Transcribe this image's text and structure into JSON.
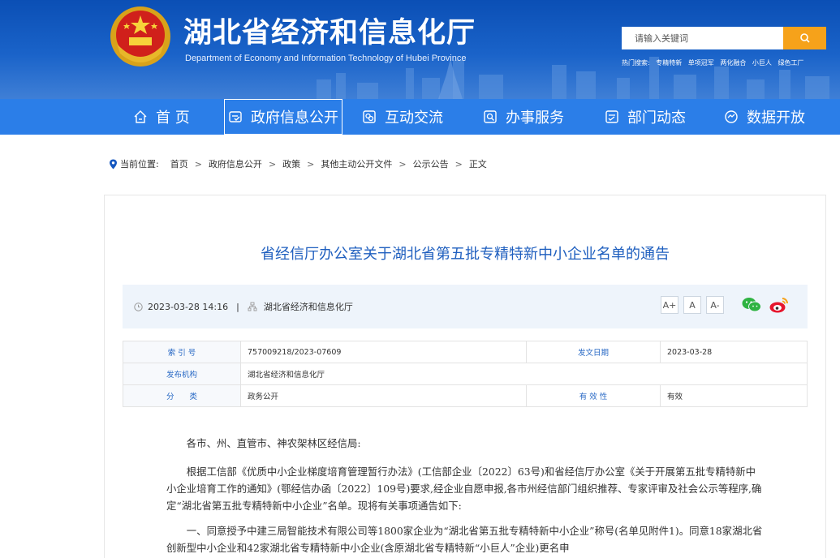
{
  "header": {
    "title": "湖北省经济和信息化厅",
    "subtitle": "Department of Economy and Information Technology of Hubei Province",
    "search_placeholder": "请输入关键词",
    "search_button_icon": "search-icon",
    "hot_label": "热门搜索:",
    "hot_words": [
      "专精特新",
      "单项冠军",
      "两化融合",
      "小巨人",
      "绿色工厂"
    ]
  },
  "nav": {
    "items": [
      {
        "label": "首 页",
        "icon": "home-icon"
      },
      {
        "label": "政府信息公开",
        "icon": "document-icon"
      },
      {
        "label": "互动交流",
        "icon": "chat-icon"
      },
      {
        "label": "办事服务",
        "icon": "search-service-icon"
      },
      {
        "label": "部门动态",
        "icon": "news-icon"
      },
      {
        "label": "数据开放",
        "icon": "data-icon"
      }
    ],
    "active_index": 1
  },
  "breadcrumb": {
    "label": "当前位置:",
    "items": [
      "首页",
      "政府信息公开",
      "政策",
      "其他主动公开文件",
      "公示公告",
      "正文"
    ],
    "separator": ">"
  },
  "article": {
    "title": "省经信厅办公室关于湖北省第五批专精特新中小企业名单的通告",
    "datetime": "2023-03-28 14:16",
    "meta_sep": "|",
    "source": "湖北省经济和信息化厅",
    "font_buttons": [
      "A+",
      "A",
      "A-"
    ],
    "info": {
      "index_label": "索 引 号",
      "index_value": "757009218/2023-07609",
      "date_label": "发文日期",
      "date_value": "2023-03-28",
      "org_label": "发布机构",
      "org_value": "湖北省经济和信息化厅",
      "category_label": "分　　类",
      "category_value": "政务公开",
      "validity_label": "有 效 性",
      "validity_value": "有效"
    },
    "paragraphs": [
      "各市、州、直管市、神农架林区经信局:",
      "根据工信部《优质中小企业梯度培育管理暂行办法》(工信部企业〔2022〕63号)和省经信厅办公室《关于开展第五批专精特新中小企业培育工作的通知》(鄂经信办函〔2022〕109号)要求,经企业自愿申报,各市州经信部门组织推荐、专家评审及社会公示等程序,确定“湖北省第五批专精特新中小企业”名单。现将有关事项通告如下:",
      "一、同意授予中建三局智能技术有限公司等1800家企业为“湖北省第五批专精特新中小企业”称号(名单见附件1)。同意18家湖北省创新型中小企业和42家湖北省专精特新中小企业(含原湖北省专精特新“小巨人”企业)更名申"
    ]
  },
  "colors": {
    "header_blue": "#0b4fb5",
    "nav_blue": "#2b7ee8",
    "search_orange": "#f6a21a",
    "title_blue": "#1f5fbf",
    "wechat_green": "#2fb342",
    "weibo_red": "#e6162d"
  }
}
